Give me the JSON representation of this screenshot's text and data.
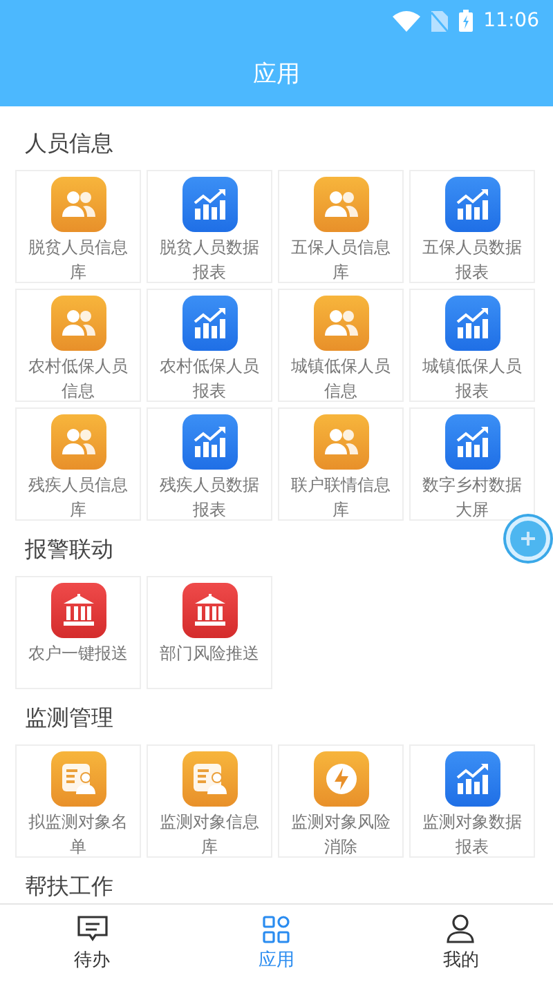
{
  "status_bar": {
    "time": "11:06"
  },
  "header": {
    "title": "应用"
  },
  "sections": [
    {
      "title": "人员信息",
      "items": [
        {
          "label": "脱贫人员信息库",
          "kind": "people"
        },
        {
          "label": "脱贫人员数据报表",
          "kind": "chart"
        },
        {
          "label": "五保人员信息库",
          "kind": "people"
        },
        {
          "label": "五保人员数据报表",
          "kind": "chart"
        },
        {
          "label": "农村低保人员信息",
          "kind": "people"
        },
        {
          "label": "农村低保人员报表",
          "kind": "chart"
        },
        {
          "label": "城镇低保人员信息",
          "kind": "people"
        },
        {
          "label": "城镇低保人员报表",
          "kind": "chart"
        },
        {
          "label": "残疾人员信息库",
          "kind": "people"
        },
        {
          "label": "残疾人员数据报表",
          "kind": "chart"
        },
        {
          "label": "联户联情信息库",
          "kind": "people"
        },
        {
          "label": "数字乡村数据大屏",
          "kind": "chart"
        }
      ]
    },
    {
      "title": "报警联动",
      "items": [
        {
          "label": "农户一键报送",
          "kind": "alarm"
        },
        {
          "label": "部门风险推送",
          "kind": "alarm"
        }
      ]
    },
    {
      "title": "监测管理",
      "items": [
        {
          "label": "拟监测对象名单",
          "kind": "roster"
        },
        {
          "label": "监测对象信息库",
          "kind": "roster"
        },
        {
          "label": "监测对象风险消除",
          "kind": "bolt"
        },
        {
          "label": "监测对象数据报表",
          "kind": "chart"
        }
      ]
    },
    {
      "title": "帮扶工作"
    }
  ],
  "tabs": [
    {
      "label": "待办",
      "kind": "message",
      "selected": false
    },
    {
      "label": "应用",
      "kind": "grid",
      "selected": true
    },
    {
      "label": "我的",
      "kind": "user",
      "selected": false
    }
  ]
}
